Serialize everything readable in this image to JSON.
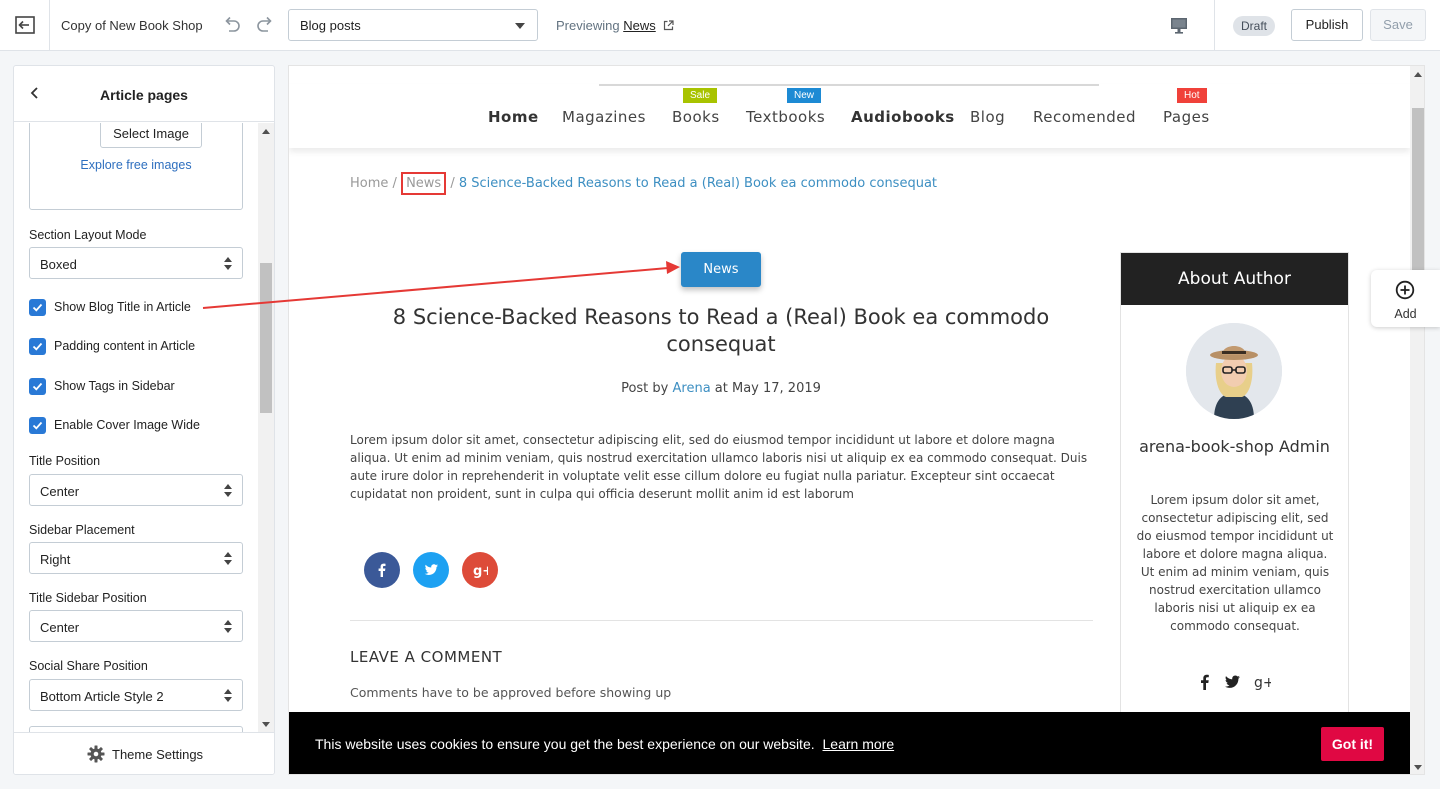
{
  "topbar": {
    "store_name": "Copy of New Book Shop",
    "page_select": "Blog posts",
    "previewing_prefix": "Previewing",
    "previewing_link": "News",
    "draft": "Draft",
    "publish": "Publish",
    "save": "Save"
  },
  "sidebar": {
    "title": "Article pages",
    "select_image": "Select Image",
    "explore_images": "Explore free images",
    "section_layout_label": "Section Layout Mode",
    "section_layout_value": "Boxed",
    "checkboxes": [
      {
        "label": "Show Blog Title in Article",
        "checked": true
      },
      {
        "label": "Padding content in Article",
        "checked": true
      },
      {
        "label": "Show Tags in Sidebar",
        "checked": true
      },
      {
        "label": "Enable Cover Image Wide",
        "checked": true
      }
    ],
    "title_position_label": "Title Position",
    "title_position_value": "Center",
    "sidebar_placement_label": "Sidebar Placement",
    "sidebar_placement_value": "Right",
    "title_sidebar_position_label": "Title Sidebar Position",
    "title_sidebar_position_value": "Center",
    "social_share_label": "Social Share Position",
    "social_share_value": "Bottom Article Style 2",
    "footer": "Theme Settings"
  },
  "preview": {
    "nav": [
      {
        "label": "Home",
        "badge": ""
      },
      {
        "label": "Magazines",
        "badge": ""
      },
      {
        "label": "Books",
        "badge": "Sale"
      },
      {
        "label": "Textbooks",
        "badge": "New"
      },
      {
        "label": "Audiobooks",
        "badge": ""
      },
      {
        "label": "Blog",
        "badge": ""
      },
      {
        "label": "Recomended",
        "badge": ""
      },
      {
        "label": "Pages",
        "badge": "Hot"
      }
    ],
    "breadcrumb": {
      "home": "Home",
      "sep": "/",
      "news": "News",
      "current": "8 Science-Backed Reasons to Read a (Real) Book ea commodo consequat"
    },
    "category_button": "News",
    "title": "8 Science-Backed Reasons to Read a (Real) Book ea commodo consequat",
    "meta_prefix": "Post by",
    "meta_author": "Arena",
    "meta_date": "at May 17, 2019",
    "body": "Lorem ipsum dolor sit amet, consectetur adipiscing elit, sed do eiusmod tempor incididunt ut labore et dolore magna aliqua. Ut enim ad minim veniam, quis nostrud exercitation ullamco laboris nisi ut aliquip ex ea commodo consequat. Duis aute irure dolor in reprehenderit in voluptate velit esse cillum dolore eu fugiat nulla pariatur. Excepteur sint occaecat cupidatat non proident, sunt in culpa qui officia deserunt mollit anim id est laborum",
    "leave_comment": "LEAVE A COMMENT",
    "comments_note": "Comments have to be approved before showing up",
    "about_author": {
      "heading": "About Author",
      "name": "arena-book-shop Admin",
      "bio": "Lorem ipsum dolor sit amet, consectetur adipiscing elit, sed do eiusmod tempor incididunt ut labore et dolore magna aliqua. Ut enim ad minim veniam, quis nostrud exercitation ullamco laboris nisi ut aliquip ex ea commodo consequat."
    },
    "cookie": {
      "text": "This website uses cookies to ensure you get the best experience on our website.",
      "learn_more": "Learn more",
      "button": "Got it!"
    }
  },
  "add_button": "Add",
  "colors": {
    "accent_blue": "#2979d6",
    "news_button": "#2a87c8",
    "link_blue": "#3d8fc2",
    "badge_sale": "#a8c300",
    "badge_new": "#1d8ad4",
    "badge_hot": "#f0413a",
    "facebook": "#3b5998",
    "twitter": "#1da1f2",
    "google_plus": "#dd4b39",
    "cookie_button": "#e00843",
    "annotation_red": "#e53935"
  }
}
